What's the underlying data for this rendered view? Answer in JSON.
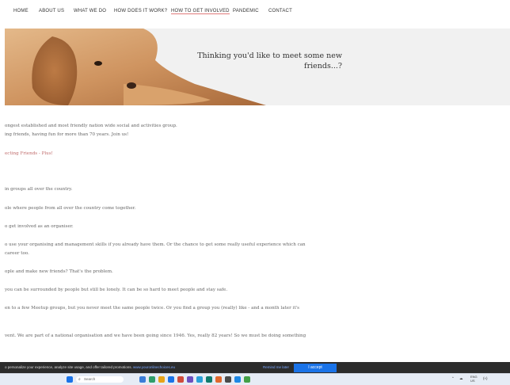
{
  "nav": {
    "items": [
      "HOME",
      "ABOUT US",
      "WHAT WE DO",
      "HOW DOES IT WORK?",
      "HOW TO GET INVOLVED",
      "PANDEMIC",
      "CONTACT"
    ]
  },
  "hero": {
    "line1": "Thinking you'd like to meet some new",
    "line2": "friends...?"
  },
  "content": {
    "lines": [
      "ongest established and most friendly nation wide social and activities group.",
      "ing friends, having fun for more than 70 years. Join us!",
      "ecting Friends - Plus!",
      " in groups all over the country.",
      "ole where people from all over the country come together.",
      "o get involved as an organiser.",
      "o use your organising and management skills if you already have them. Or the chance to get some really useful experience which can",
      " career too.",
      "ople and make new friends? That's the problem.",
      " you can be surrounded by people but still be lonely. It can be so hard to meet people and stay safe.",
      "en to a few Meetup groups, but you never meet the same people twice. Or you find a group you (really) like - and a month later it's",
      "vent. We are part of a national organisation and we have been going since 1946. Yes, really 82 years! So we must be doing something"
    ]
  },
  "cookie": {
    "text": "o personalize your experience, analyze site usage, and offer tailored promotions.",
    "policy_link": "www.youronlinechoices.eu",
    "reject_label": "Remind me later",
    "accept_label": "I accept"
  },
  "taskbar": {
    "search_placeholder": "Search",
    "lang": "ENG",
    "lang_region": "US",
    "wifi": "(≈)",
    "icon_colors": [
      "#3b7dd8",
      "#2f9e6a",
      "#e8a317",
      "#1a73e8",
      "#d04b3b",
      "#6c4fbf",
      "#2aa0d8",
      "#0f7b6c",
      "#e0682d",
      "#4a4a4a",
      "#1e88e5",
      "#43a047"
    ],
    "start_color": "#1a73e8"
  }
}
